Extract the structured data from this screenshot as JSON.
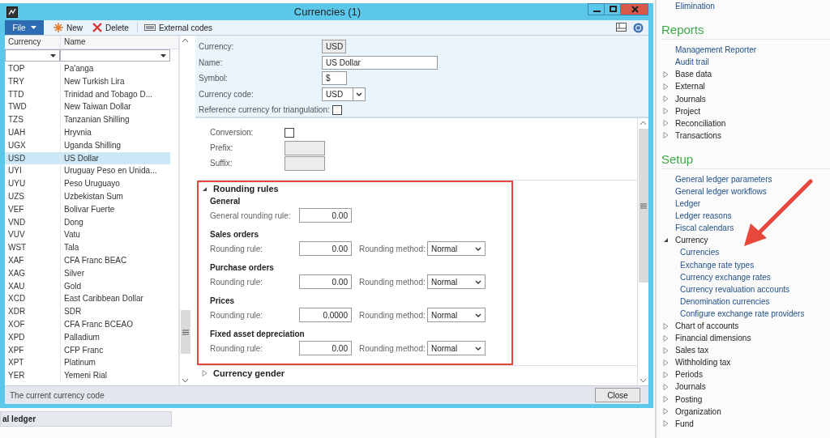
{
  "window": {
    "title": "Currencies (1)"
  },
  "toolbar": {
    "file_menu": "File",
    "buttons": [
      {
        "kind": "new",
        "label": "New"
      },
      {
        "kind": "delete",
        "label": "Delete"
      },
      {
        "kind": "codes",
        "label": "External codes"
      }
    ]
  },
  "currency_list": {
    "columns": [
      "Currency",
      "Name"
    ],
    "rows": [
      {
        "code": "TOP",
        "name": "Pa'anga",
        "selected": false
      },
      {
        "code": "TRY",
        "name": "New Turkish Lira",
        "selected": false
      },
      {
        "code": "TTD",
        "name": "Trinidad and Tobago D...",
        "selected": false
      },
      {
        "code": "TWD",
        "name": "New Taiwan Dollar",
        "selected": false
      },
      {
        "code": "TZS",
        "name": "Tanzanian Shilling",
        "selected": false
      },
      {
        "code": "UAH",
        "name": "Hryvnia",
        "selected": false
      },
      {
        "code": "UGX",
        "name": "Uganda Shilling",
        "selected": false
      },
      {
        "code": "USD",
        "name": "US Dollar",
        "selected": true
      },
      {
        "code": "UYI",
        "name": "Uruguay Peso en Unida...",
        "selected": false
      },
      {
        "code": "UYU",
        "name": "Peso Uruguayo",
        "selected": false
      },
      {
        "code": "UZS",
        "name": "Uzbekistan Sum",
        "selected": false
      },
      {
        "code": "VEF",
        "name": "Bolivar Fuerte",
        "selected": false
      },
      {
        "code": "VND",
        "name": "Dong",
        "selected": false
      },
      {
        "code": "VUV",
        "name": "Vatu",
        "selected": false
      },
      {
        "code": "WST",
        "name": "Tala",
        "selected": false
      },
      {
        "code": "XAF",
        "name": "CFA Franc BEAC",
        "selected": false
      },
      {
        "code": "XAG",
        "name": "Silver",
        "selected": false
      },
      {
        "code": "XAU",
        "name": "Gold",
        "selected": false
      },
      {
        "code": "XCD",
        "name": "East Caribbean Dollar",
        "selected": false
      },
      {
        "code": "XDR",
        "name": "SDR",
        "selected": false
      },
      {
        "code": "XOF",
        "name": "CFA Franc BCEAO",
        "selected": false
      },
      {
        "code": "XPD",
        "name": "Palladium",
        "selected": false
      },
      {
        "code": "XPF",
        "name": "CFP Franc",
        "selected": false
      },
      {
        "code": "XPT",
        "name": "Platinum",
        "selected": false
      },
      {
        "code": "YER",
        "name": "Yemeni Rial",
        "selected": false
      }
    ]
  },
  "header_fields": [
    {
      "kind": "readonly",
      "label": "Currency:",
      "value": "USD"
    },
    {
      "kind": "text",
      "label": "Name:",
      "value": "US Dollar"
    },
    {
      "kind": "short",
      "label": "Symbol:",
      "value": "$"
    },
    {
      "kind": "dropdown",
      "label": "Currency code:",
      "value": "USD"
    },
    {
      "kind": "checkbox",
      "label": "Reference currency for triangulation:",
      "checked": false
    }
  ],
  "conversion_fields": [
    {
      "kind": "checkbox",
      "label": "Conversion:",
      "checked": false
    },
    {
      "kind": "disabled",
      "label": "Prefix:"
    },
    {
      "kind": "disabled",
      "label": "Suffix:"
    }
  ],
  "rounding_rules": {
    "title": "Rounding rules",
    "expanded": true,
    "highlighted": true,
    "groups": [
      {
        "title": "General",
        "rule_label": "General rounding rule:",
        "rule": "0.00"
      },
      {
        "title": "Sales orders",
        "rule_label": "Rounding rule:",
        "rule": "0.00",
        "method_label": "Rounding method:",
        "method": "Normal"
      },
      {
        "title": "Purchase orders",
        "rule_label": "Rounding rule:",
        "rule": "0.00",
        "method_label": "Rounding method:",
        "method": "Normal"
      },
      {
        "title": "Prices",
        "rule_label": "Rounding rule:",
        "rule": "0.0000",
        "method_label": "Rounding method:",
        "method": "Normal"
      },
      {
        "title": "Fixed asset depreciation",
        "rule_label": "Rounding rule:",
        "rule": "0.00",
        "method_label": "Rounding method:",
        "method": "Normal"
      }
    ]
  },
  "currency_gender": {
    "title": "Currency gender",
    "expanded": false
  },
  "status_bar": {
    "text": "The current currency code",
    "close": "Close"
  },
  "background_panel": {
    "title": "al ledger"
  },
  "navigation": [
    {
      "items": [
        {
          "kind": "link",
          "label": "Elimination"
        }
      ]
    },
    {
      "title": "Reports",
      "items": [
        {
          "kind": "link",
          "label": "Management Reporter"
        },
        {
          "kind": "link",
          "label": "Audit trail"
        },
        {
          "kind": "folder",
          "label": "Base data",
          "expanded": false
        },
        {
          "kind": "folder",
          "label": "External",
          "expanded": false
        },
        {
          "kind": "folder",
          "label": "Journals",
          "expanded": false
        },
        {
          "kind": "folder",
          "label": "Project",
          "expanded": false
        },
        {
          "kind": "folder",
          "label": "Reconciliation",
          "expanded": false
        },
        {
          "kind": "folder",
          "label": "Transactions",
          "expanded": false
        }
      ]
    },
    {
      "title": "Setup",
      "items": [
        {
          "kind": "link",
          "label": "General ledger parameters"
        },
        {
          "kind": "link",
          "label": "General ledger workflows"
        },
        {
          "kind": "link",
          "label": "Ledger"
        },
        {
          "kind": "link",
          "label": "Ledger reasons"
        },
        {
          "kind": "link",
          "label": "Fiscal calendars"
        },
        {
          "kind": "folder",
          "label": "Currency",
          "expanded": true,
          "children": [
            {
              "kind": "link",
              "label": "Currencies",
              "pointed": true
            },
            {
              "kind": "link",
              "label": "Exchange rate types",
              "pointed": false
            },
            {
              "kind": "link",
              "label": "Currency exchange rates",
              "pointed": false
            },
            {
              "kind": "link",
              "label": "Currency revaluation accounts",
              "pointed": false
            },
            {
              "kind": "link",
              "label": "Denomination currencies",
              "pointed": false
            },
            {
              "kind": "link",
              "label": "Configure exchange rate providers",
              "pointed": false
            }
          ]
        },
        {
          "kind": "folder",
          "label": "Chart of accounts",
          "expanded": false
        },
        {
          "kind": "folder",
          "label": "Financial dimensions",
          "expanded": false
        },
        {
          "kind": "folder",
          "label": "Sales tax",
          "expanded": false
        },
        {
          "kind": "folder",
          "label": "Withholding tax",
          "expanded": false
        },
        {
          "kind": "folder",
          "label": "Periods",
          "expanded": false
        },
        {
          "kind": "folder",
          "label": "Journals",
          "expanded": false
        },
        {
          "kind": "folder",
          "label": "Posting",
          "expanded": false
        },
        {
          "kind": "folder",
          "label": "Organization",
          "expanded": false
        },
        {
          "kind": "folder",
          "label": "Fund",
          "expanded": false
        }
      ]
    }
  ]
}
